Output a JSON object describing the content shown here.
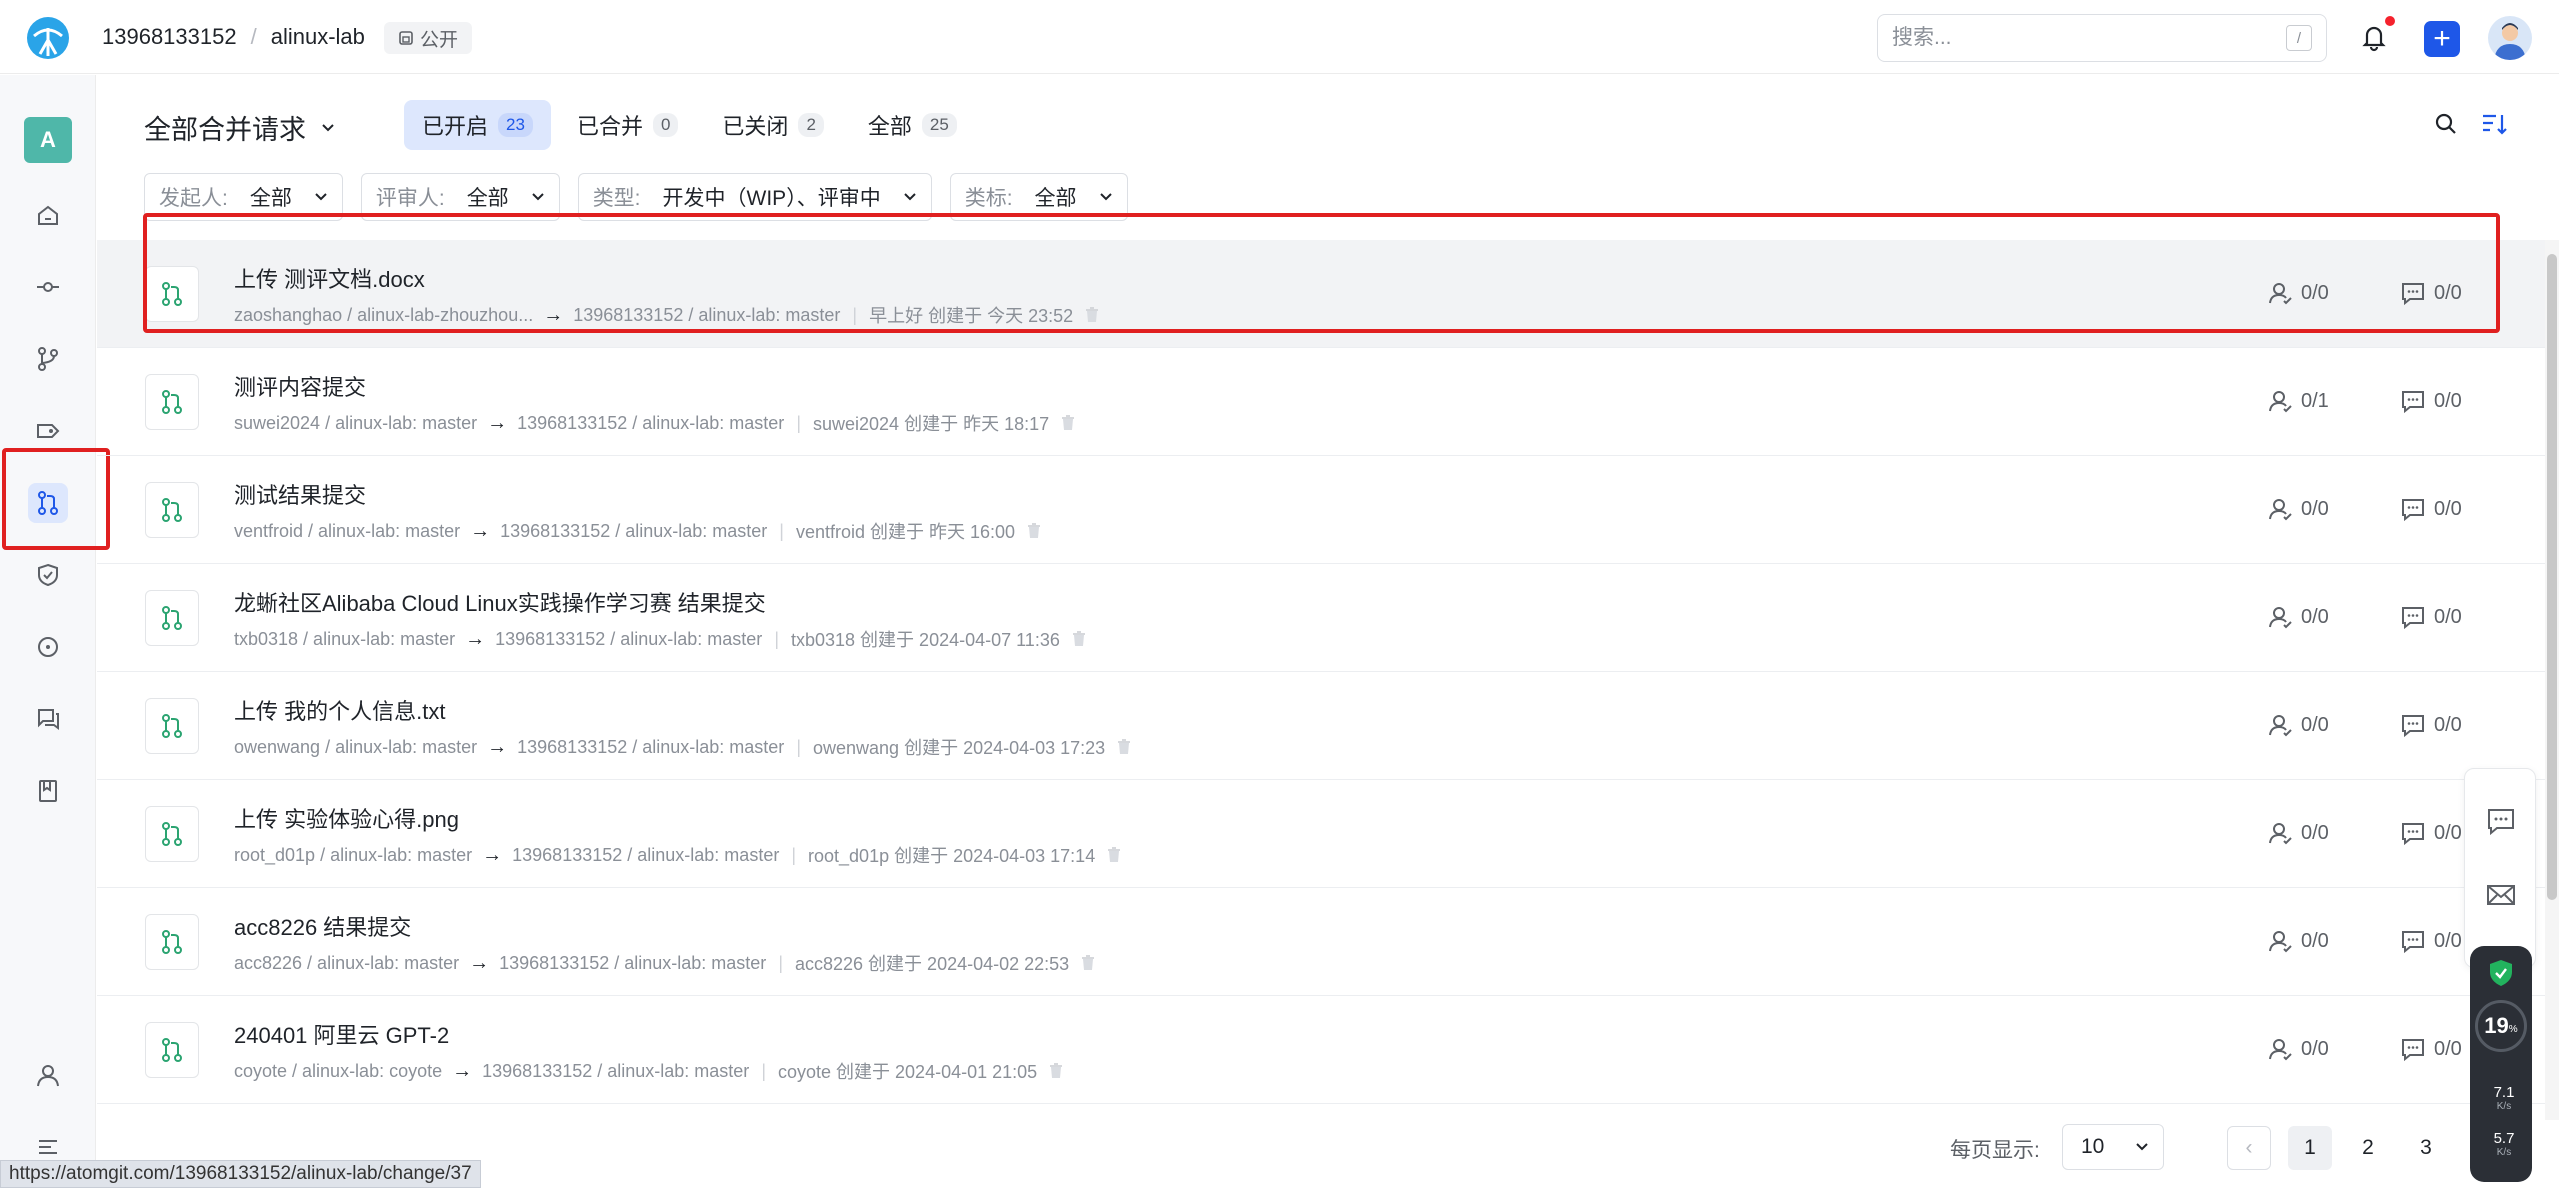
{
  "header": {
    "owner": "13968133152",
    "separator": "/",
    "repo": "alinux-lab",
    "visibility": "公开",
    "search_placeholder": "搜索...",
    "search_shortcut": "/",
    "plus_label": "+"
  },
  "sidebar": {
    "avatar_letter": "A",
    "items": [
      {
        "icon": "home-icon"
      },
      {
        "icon": "commit-icon"
      },
      {
        "icon": "branch-icon"
      },
      {
        "icon": "tag-icon"
      },
      {
        "icon": "merge-request-icon",
        "active": true
      },
      {
        "icon": "shield-icon"
      },
      {
        "icon": "issue-icon"
      },
      {
        "icon": "discussion-icon"
      },
      {
        "icon": "wiki-icon"
      },
      {
        "icon": "member-icon"
      },
      {
        "icon": "collapse-icon"
      }
    ]
  },
  "main": {
    "title": "全部合并请求",
    "tabs": [
      {
        "label": "已开启",
        "count": "23",
        "active": true
      },
      {
        "label": "已合并",
        "count": "0"
      },
      {
        "label": "已关闭",
        "count": "2"
      },
      {
        "label": "全部",
        "count": "25"
      }
    ],
    "filters": [
      {
        "label": "发起人:",
        "value": "全部"
      },
      {
        "label": "评审人:",
        "value": "全部"
      },
      {
        "label": "类型:",
        "value": "开发中（WIP）、评审中"
      },
      {
        "label": "类标:",
        "value": "全部"
      }
    ],
    "merge_requests": [
      {
        "title": "上传 测评文档.docx",
        "source": "zaoshanghao / alinux-lab-zhouzhou...",
        "target": "13968133152 / alinux-lab: master",
        "created": "早上好 创建于 今天 23:52",
        "reviewers": "0/0",
        "comments": "0/0"
      },
      {
        "title": "测评内容提交",
        "source": "suwei2024 / alinux-lab: master",
        "target": "13968133152 / alinux-lab: master",
        "created": "suwei2024 创建于 昨天 18:17",
        "reviewers": "0/1",
        "comments": "0/0"
      },
      {
        "title": "测试结果提交",
        "source": "ventfroid / alinux-lab: master",
        "target": "13968133152 / alinux-lab: master",
        "created": "ventfroid 创建于 昨天 16:00",
        "reviewers": "0/0",
        "comments": "0/0"
      },
      {
        "title": "龙蜥社区Alibaba Cloud Linux实践操作学习赛 结果提交",
        "source": "txb0318 / alinux-lab: master",
        "target": "13968133152 / alinux-lab: master",
        "created": "txb0318 创建于 2024-04-07 11:36",
        "reviewers": "0/0",
        "comments": "0/0"
      },
      {
        "title": "上传 我的个人信息.txt",
        "source": "owenwang / alinux-lab: master",
        "target": "13968133152 / alinux-lab: master",
        "created": "owenwang 创建于 2024-04-03 17:23",
        "reviewers": "0/0",
        "comments": "0/0"
      },
      {
        "title": "上传 实验体验心得.png",
        "source": "root_d01p / alinux-lab: master",
        "target": "13968133152 / alinux-lab: master",
        "created": "root_d01p 创建于 2024-04-03 17:14",
        "reviewers": "0/0",
        "comments": "0/0"
      },
      {
        "title": "acc8226 结果提交",
        "source": "acc8226 / alinux-lab: master",
        "target": "13968133152 / alinux-lab: master",
        "created": "acc8226 创建于 2024-04-02 22:53",
        "reviewers": "0/0",
        "comments": "0/0"
      },
      {
        "title": "240401 阿里云 GPT-2",
        "source": "coyote / alinux-lab: coyote",
        "target": "13968133152 / alinux-lab: master",
        "created": "coyote 创建于 2024-04-01 21:05",
        "reviewers": "0/0",
        "comments": "0/0"
      }
    ]
  },
  "pagination": {
    "per_page_label": "每页显示:",
    "per_page_value": "10",
    "prev": "‹",
    "pages": [
      "1",
      "2",
      "3"
    ],
    "current": "1"
  },
  "speed_widget": {
    "percent": "19",
    "percent_unit": "%",
    "up": "7.1",
    "down": "5.7",
    "unit": "K/s"
  },
  "status_url": "https://atomgit.com/13968133152/alinux-lab/change/37",
  "colors": {
    "accent": "#1e57e8",
    "mr_open": "#2ba471",
    "highlight": "#e02020"
  }
}
